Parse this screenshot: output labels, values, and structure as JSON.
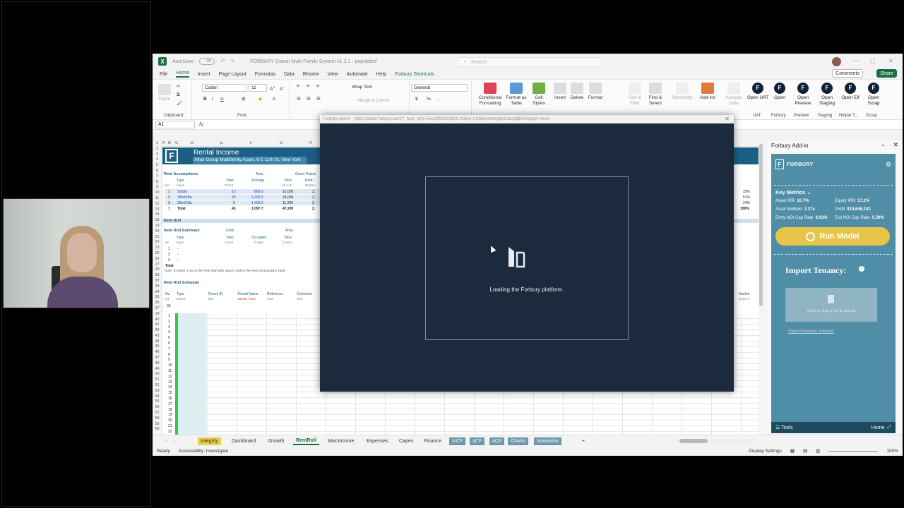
{
  "window": {
    "autosave": "AutoSave",
    "autosave_state": "Off",
    "title": "FORBURY Datum Multi Family System v1.3.1 - populated",
    "search_placeholder": "Search"
  },
  "menu": {
    "items": [
      "File",
      "Home",
      "Insert",
      "Page Layout",
      "Formulas",
      "Data",
      "Review",
      "View",
      "Automate",
      "Help",
      "Forbury Shortcuts"
    ],
    "comments": "Comments",
    "share": "Share"
  },
  "ribbon": {
    "clipboard": "Clipboard",
    "paste": "Paste",
    "font_name": "Calibri",
    "font_size": "11",
    "font": "Font",
    "wrap_text": "Wrap Text",
    "merge_center": "Merge & Center",
    "number_format": "General",
    "conditional": "Conditional Formatting",
    "format_table": "Format as Table",
    "cell_styles": "Cell Styles",
    "insert": "Insert",
    "delete": "Delete",
    "format": "Format",
    "sort_filter": "Sort & Filter",
    "find_select": "Find & Select",
    "sensitivity": "Sensitivity",
    "addins": "Add-ins",
    "analyze": "Analyze Data",
    "forbury_buttons": [
      {
        "label": "Open UAT",
        "group": "UAT"
      },
      {
        "label": "Open",
        "group": "Forbury"
      },
      {
        "label": "Open Preview",
        "group": "Preview"
      },
      {
        "label": "Open Staging",
        "group": "Staging"
      },
      {
        "label": "Open Elf",
        "group": "Helper T..."
      },
      {
        "label": "Open Scrap",
        "group": "Scrap"
      }
    ]
  },
  "formula_bar": {
    "cell_ref": "A1",
    "fx": "fx"
  },
  "sheet": {
    "columns": [
      "A",
      "B",
      "C",
      "D",
      "E",
      "F",
      "G",
      "H"
    ],
    "title": "Rental Income",
    "subtitle": "Altus Group Multifamily Asset, 6 E 11th St, New York",
    "rent_assumptions": "Rent Assumptions",
    "area": "Area",
    "gross_potential": "Gross Potent",
    "hdr_type": "Type",
    "hdr_total": "Total",
    "hdr_average": "Average",
    "hdr_total2": "Total",
    "hdr_rent": "Rent / ",
    "sub_no": "No.",
    "sub_input": "Input",
    "sub_count": "Count",
    "sub_nla": "NLA ft²",
    "sub_sqft": "$/sqft p",
    "assumption_rows": [
      {
        "no": "1",
        "type": "Studio",
        "total": "15",
        "avg": "800.0",
        "nla": "12,000",
        "rent": "2,"
      },
      {
        "no": "2",
        "type": "1Bed1Ba",
        "total": "20",
        "avg": "1,200.0",
        "nla": "24,000",
        "rent": "2,"
      },
      {
        "no": "3",
        "type": "2Bed1Ba",
        "total": "8",
        "avg": "1,400.0",
        "nla": "11,200",
        "rent": "2,"
      }
    ],
    "total_label": "Total",
    "total_units": "43",
    "total_avg": "1,097.7",
    "total_nla": "47,200",
    "total_rent": "2,",
    "rent_roll": "Rent Roll",
    "rent_roll_summary": "Rent Roll Summary",
    "units": "Units",
    "occupied": "Occupied",
    "summary_nos": [
      "1",
      "2",
      "3"
    ],
    "summary_dash": "-",
    "note": "Note: To insert a row in the Rent Roll table above, click in the Rent Assumptions Table",
    "rent_roll_schedule": "Rent Roll Schedule",
    "sched_headers": [
      "No.",
      "Type",
      "Tenant ID",
      "Tenant Name",
      "Reference",
      "Comment"
    ],
    "sched_sub": [
      "(x)",
      "Select",
      "Text",
      "Vacant / Text",
      "Text",
      "Text"
    ],
    "sched_count": "35",
    "right_pct": [
      "25%",
      "51%",
      "24%",
      "100%"
    ],
    "market": "Market",
    "market_sub": "$ per m"
  },
  "row_numbers": [
    "1",
    "2",
    "3",
    "4",
    "5",
    "6",
    "7",
    "8",
    "9",
    "10",
    "11",
    "12",
    "13",
    "15",
    "18",
    "19",
    "20",
    "21",
    "22",
    "23",
    "25",
    "26",
    "27",
    "29",
    "30",
    "32",
    "33",
    "34",
    "35",
    "36",
    "37",
    "39",
    "40",
    "41",
    "42",
    "43",
    "44",
    "45",
    "46",
    "47",
    "48",
    "49",
    "50",
    "51",
    "52",
    "53",
    "54",
    "55",
    "56",
    "57",
    "58",
    "59",
    "60"
  ],
  "schedule_rows": [
    "1",
    "2",
    "3",
    "4",
    "5",
    "6",
    "7",
    "8",
    "9",
    "10",
    "11",
    "12",
    "13",
    "14",
    "15",
    "16",
    "17",
    "18",
    "19",
    "20",
    "21",
    "22"
  ],
  "tabs": [
    {
      "label": "Integrity",
      "style": "yellow"
    },
    {
      "label": "Dashboard",
      "style": "plain"
    },
    {
      "label": "Growth",
      "style": "plain"
    },
    {
      "label": "RentRoll",
      "style": "active"
    },
    {
      "label": "MiscIncome",
      "style": "plain"
    },
    {
      "label": "Expenses",
      "style": "plain"
    },
    {
      "label": "Capex",
      "style": "plain"
    },
    {
      "label": "Finance",
      "style": "plain"
    },
    {
      "label": "mCF",
      "style": "slate"
    },
    {
      "label": "qCF",
      "style": "slate"
    },
    {
      "label": "aCF",
      "style": "slate"
    },
    {
      "label": "Charts",
      "style": "slate"
    },
    {
      "label": "Scenarios",
      "style": "slate"
    }
  ],
  "status": {
    "ready": "Ready",
    "accessibility": "Accessibility: Investigate",
    "display_settings": "Display Settings",
    "zoom": "100%"
  },
  "pane": {
    "title": "Forbury Add-in",
    "brand": "FORBURY",
    "key_metrics": "Key Metrics",
    "metrics": [
      {
        "label": "Asset IRR:",
        "value": "10.7%"
      },
      {
        "label": "Equity IRR:",
        "value": "17.2%"
      },
      {
        "label": "Asset Multiple:",
        "value": "2.27x"
      },
      {
        "label": "Profit:",
        "value": "$19,645,183"
      },
      {
        "label": "Entry NOI Cap Rate:",
        "value": "6.63%"
      },
      {
        "label": "Exit NOI Cap Rate:",
        "value": "5.50%"
      }
    ],
    "run_model": "Run Model",
    "import_tenancy": "Import Tenancy:",
    "upload_hint": "Click or drag a file to upload",
    "view_previous": "View Previous Imports",
    "tools": "Tools",
    "home": "Home"
  },
  "modal": {
    "title": "Forbury Add-in - https://addin.forbury.com/?_host_Info=Excel$Win32$16.01$en-US$telemetry$isDialog$$0#/import-excel",
    "loading": "Loading the Forbury platform."
  }
}
